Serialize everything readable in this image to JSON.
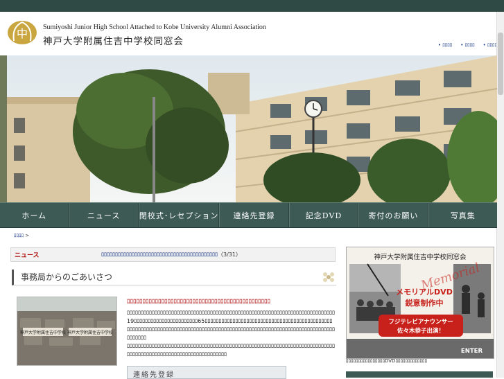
{
  "header": {
    "logo_emblem": "中",
    "title_en": "Sumiyoshi Junior High School Attached to Kobe University Alumni Association",
    "title_ja": "神戸大学附属住吉中学校同窓会",
    "util_links": [
      "ﾛﾛﾛﾛ",
      "ﾛﾛﾛﾛ",
      "ﾛﾛﾛﾛ"
    ]
  },
  "nav": {
    "items": [
      "ホーム",
      "ニュース",
      "閉校式･レセプション",
      "連絡先登録",
      "記念DVD",
      "寄付のお願い",
      "写真集"
    ]
  },
  "breadcrumb": {
    "home": "ﾛﾛﾛﾛ",
    "separator": ">"
  },
  "news": {
    "label": "ニュース",
    "link": "ﾛﾛﾛﾛﾛﾛﾛﾛﾛﾛﾛﾛﾛﾛﾛﾛﾛﾛﾛﾛﾛﾛﾛﾛﾛﾛﾛﾛﾛﾛﾛﾛﾛﾛﾛﾛﾛﾛﾛﾛﾛﾛ",
    "date": "（3/31）"
  },
  "section": {
    "title": "事務局からのごあいさつ"
  },
  "photo": {
    "sign_text": "神戸大学附属住吉中学校 神戸大学附属住吉中学校"
  },
  "article": {
    "title": "ﾛﾛﾛﾛﾛﾛﾛﾛﾛﾛﾛﾛﾛﾛﾛﾛﾛﾛﾛﾛﾛﾛﾛﾛﾛﾛﾛﾛﾛﾛﾛﾛﾛﾛﾛﾛﾛﾛﾛﾛﾛﾛﾛﾛﾛﾛ",
    "p1": "ﾛﾛﾛﾛﾛﾛﾛﾛﾛﾛﾛﾛﾛﾛﾛﾛﾛﾛﾛﾛﾛﾛﾛﾛﾛﾛﾛﾛﾛﾛﾛﾛﾛﾛﾛﾛﾛﾛﾛﾛﾛﾛﾛﾛﾛﾛﾛﾛﾛﾛﾛﾛﾛﾛﾛﾛﾛﾛﾛﾛﾛﾛﾛﾛﾛﾛﾛﾛﾛﾛﾛﾛﾛﾛﾛ19ﾛﾛﾛﾛﾛﾛﾛﾛﾛﾛﾛﾛﾛﾛﾛﾛﾛﾛﾛﾛﾛﾛﾛ65ﾛﾛﾛﾛﾛﾛﾛﾛﾛﾛﾛﾛﾛﾛﾛﾛﾛﾛﾛﾛﾛﾛﾛﾛﾛﾛﾛﾛﾛﾛﾛﾛﾛﾛﾛﾛﾛﾛﾛﾛﾛﾛﾛﾛﾛﾛﾛﾛﾛﾛﾛﾛﾛﾛﾛﾛﾛﾛﾛﾛﾛﾛﾛﾛﾛﾛﾛﾛﾛﾛﾛﾛﾛﾛﾛﾛﾛﾛﾛﾛﾛﾛﾛﾛﾛﾛﾛﾛﾛﾛﾛﾛﾛﾛﾛﾛﾛﾛﾛﾛﾛﾛﾛﾛﾛﾛﾛﾛﾛﾛﾛﾛﾛﾛﾛﾛﾛﾛﾛﾛﾛﾛﾛﾛﾛﾛﾛﾛ",
    "p2": "ﾛﾛﾛﾛﾛﾛﾛﾛﾛﾛﾛﾛﾛﾛﾛﾛﾛﾛﾛﾛﾛﾛﾛﾛﾛﾛﾛﾛﾛﾛﾛﾛﾛﾛﾛﾛﾛﾛﾛﾛﾛﾛﾛﾛﾛﾛﾛﾛﾛﾛﾛﾛﾛﾛﾛﾛﾛﾛﾛﾛﾛﾛﾛﾛﾛﾛﾛﾛﾛﾛﾛﾛﾛﾛﾛﾛﾛﾛﾛﾛﾛﾛﾛﾛﾛﾛﾛﾛﾛﾛﾛﾛﾛﾛﾛﾛﾛﾛﾛﾛﾛﾛﾛﾛﾛﾛﾛﾛﾛﾛﾛ",
    "contact_banner": "連絡先登録"
  },
  "dvd_ad": {
    "heading": "神戸大学附属住吉中学校同窓会",
    "memorial": "Memorial",
    "line1": "メモリアルDVD",
    "line2": "鋭意制作中",
    "announcer_line1": "フジテレビアナウンサー",
    "announcer_line2": "佐々木恭子出演！",
    "enter": "ENTER",
    "caption": "ﾛﾛﾛﾛﾛﾛﾛﾛﾛﾛﾛﾛﾛﾛﾛﾛDVDﾛﾛﾛﾛﾛﾛﾛﾛﾛﾛﾛﾛﾛ"
  },
  "colors": {
    "topbar": "#2f4a44",
    "nav": "#3d5a55",
    "news_label": "#b01010",
    "link": "#1a3a8a",
    "dvd_red": "#c8201a"
  }
}
